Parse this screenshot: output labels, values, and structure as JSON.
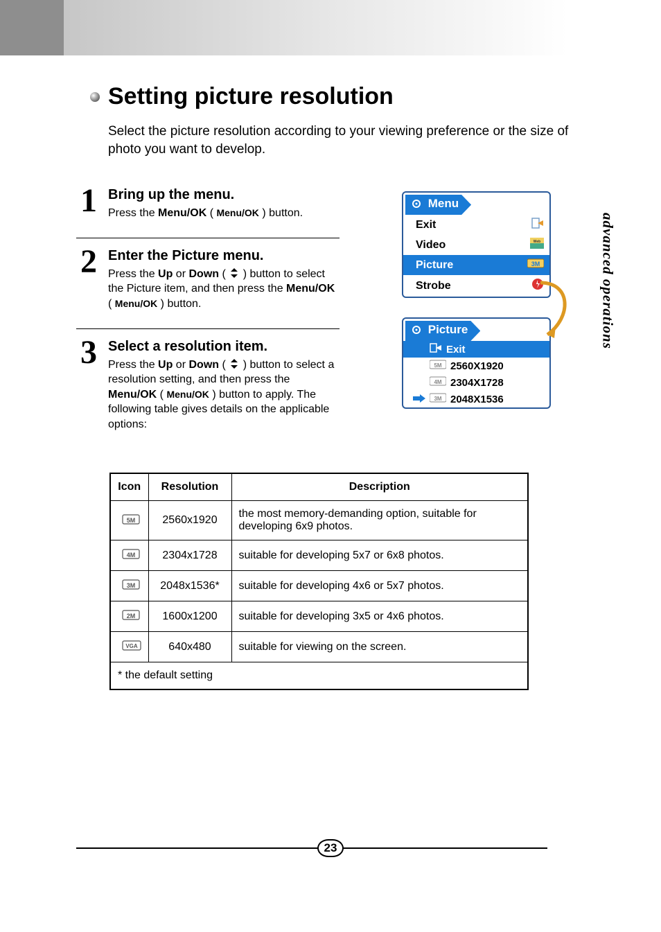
{
  "sideTab": "advanced operations",
  "heading": "Setting picture resolution",
  "intro": "Select the picture resolution according to your viewing preference or the size of photo you want to develop.",
  "steps": [
    {
      "num": "1",
      "title": "Bring up the menu.",
      "text_a": "Press the ",
      "bold_a": "Menu/OK",
      "text_b": " ( ",
      "iconLabel": "Menu/OK",
      "text_c": " ) button."
    },
    {
      "num": "2",
      "title": "Enter the Picture menu.",
      "text_a": "Press the ",
      "bold_a": "Up",
      "mid_a": " or ",
      "bold_b": "Down",
      "text_b": " ( ",
      "text_c": " ) button to select the Picture item, and then press the ",
      "bold_c": "Menu/OK",
      "text_d": " ( ",
      "iconLabel": "Menu/OK",
      "text_e": " ) button."
    },
    {
      "num": "3",
      "title": "Select a resolution item.",
      "text_a": "Press the ",
      "bold_a": "Up",
      "mid_a": " or ",
      "bold_b": "Down",
      "text_b": " ( ",
      "text_c": " ) button to select a resolution setting, and then press the ",
      "bold_c": "Menu/OK",
      "text_d": " ( ",
      "iconLabel": "Menu/OK",
      "text_e": " ) button to apply. The following table gives details on the applicable options:"
    }
  ],
  "menuPanel": {
    "title": "Menu",
    "rows": [
      {
        "label": "Exit",
        "icon": "exit-icon",
        "selected": false
      },
      {
        "label": "Video",
        "icon": "video-icon",
        "selected": false
      },
      {
        "label": "Picture",
        "icon": "res-3m-icon",
        "selected": true
      },
      {
        "label": "Strobe",
        "icon": "strobe-icon",
        "selected": false
      }
    ]
  },
  "picturePanel": {
    "title": "Picture",
    "rows": [
      {
        "label": "Exit",
        "icon": "exit-icon",
        "selected": true,
        "cursor": false
      },
      {
        "label": "2560X1920",
        "icon": "res-5m-icon",
        "selected": false,
        "cursor": false
      },
      {
        "label": "2304X1728",
        "icon": "res-4m-icon",
        "selected": false,
        "cursor": false
      },
      {
        "label": "2048X1536",
        "icon": "res-3m-icon",
        "selected": false,
        "cursor": true
      }
    ]
  },
  "table": {
    "headers": {
      "icon": "Icon",
      "res": "Resolution",
      "desc": "Description"
    },
    "rows": [
      {
        "icon": "res-5m-icon",
        "res": "2560x1920",
        "desc": "the most memory-demanding option, suitable for developing 6x9 photos."
      },
      {
        "icon": "res-4m-icon",
        "res": "2304x1728",
        "desc": "suitable for developing 5x7 or 6x8 photos."
      },
      {
        "icon": "res-3m-icon",
        "res": "2048x1536*",
        "desc": "suitable for developing 4x6 or 5x7 photos."
      },
      {
        "icon": "res-2m-icon",
        "res": "1600x1200",
        "desc": "suitable for developing 3x5 or 4x6 photos."
      },
      {
        "icon": "res-vga-icon",
        "res": "640x480",
        "desc": "suitable for viewing on the screen."
      }
    ],
    "footnote": "* the default setting"
  },
  "pageNumber": "23"
}
